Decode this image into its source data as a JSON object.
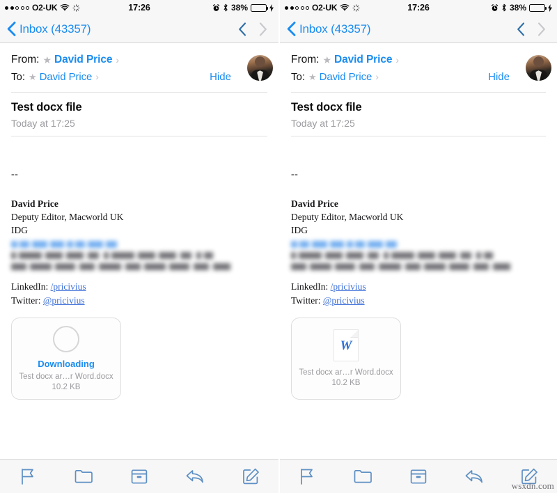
{
  "panels": [
    {
      "id": "left",
      "attachment_state": "downloading"
    },
    {
      "id": "right",
      "attachment_state": "downloaded"
    }
  ],
  "status_bar": {
    "signal_dots_filled": 2,
    "signal_dots_total": 5,
    "carrier": "O2-UK",
    "wifi_icon": "wifi-icon",
    "activity_icon": "activity-spinner-icon",
    "time": "17:26",
    "alarm_icon": "alarm-clock-icon",
    "bluetooth_icon": "bluetooth-icon",
    "battery_percent": "38%",
    "battery_level": 38,
    "battery_color": "#4cd455",
    "charging_icon": "lightning-bolt-icon"
  },
  "nav_bar": {
    "back_icon": "chevron-left-icon",
    "back_label": "Inbox (43357)",
    "prev_message_icon": "chevron-up-icon",
    "next_message_icon": "chevron-down-icon",
    "prev_enabled": true,
    "next_enabled": false,
    "accent_color": "#1a8cf0",
    "disabled_color": "#c8c8cd"
  },
  "mail_header": {
    "from_label": "From:",
    "from_name": "David Price",
    "to_label": "To:",
    "to_name": "David Price",
    "star_icon": "star-icon",
    "disclosure_icon": "chevron-right-icon",
    "hide_label": "Hide",
    "avatar_icon": "contact-avatar"
  },
  "message": {
    "subject": "Test docx file",
    "date": "Today at 17:25",
    "signature_separator": "--",
    "signature": {
      "name": "David Price",
      "title": "Deputy Editor, Macworld UK",
      "company": "IDG"
    },
    "redacted_lines": [
      "email-address-redacted",
      "phone-line-redacted",
      "address-line-redacted"
    ],
    "social": [
      {
        "label": "LinkedIn:",
        "link": "/pricivius"
      },
      {
        "label": "Twitter:",
        "link": "@pricivius"
      }
    ]
  },
  "attachment": {
    "downloading_label": "Downloading",
    "file_name": "Test docx ar…r Word.docx",
    "file_size": "10.2 KB",
    "doc_glyph": "W",
    "doc_icon": "word-document-icon",
    "progress_icon": "progress-ring-icon",
    "progress_percent": 0
  },
  "toolbar": {
    "items": [
      {
        "name": "flag-icon",
        "label": "Flag"
      },
      {
        "name": "folder-icon",
        "label": "Move to folder"
      },
      {
        "name": "archive-icon",
        "label": "Archive"
      },
      {
        "name": "reply-icon",
        "label": "Reply"
      },
      {
        "name": "compose-icon",
        "label": "Compose"
      }
    ],
    "icon_color": "#5d8fc4"
  },
  "watermark": "wsxdn.com"
}
